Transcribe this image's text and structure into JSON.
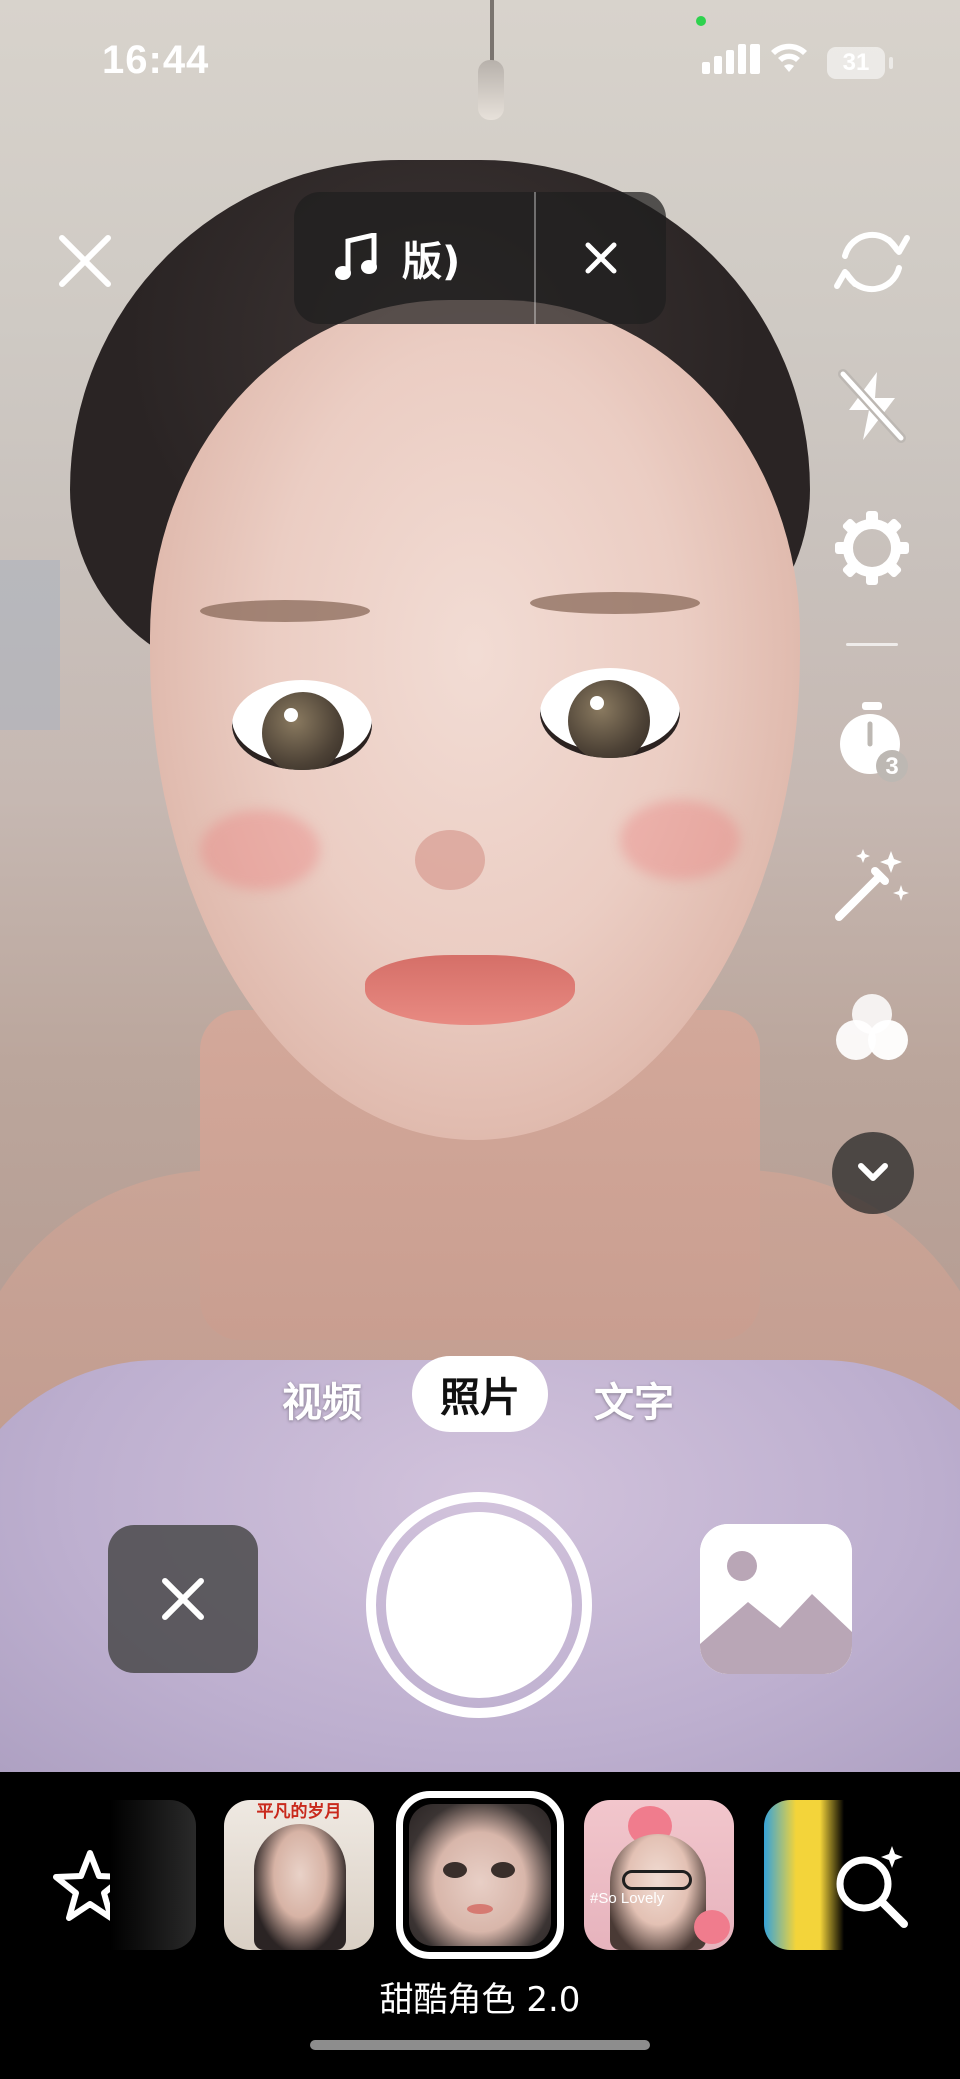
{
  "status_bar": {
    "time": "16:44",
    "battery": "31",
    "icons": [
      "camera-indicator-dot",
      "cellular-signal-icon",
      "wifi-icon",
      "battery-icon"
    ]
  },
  "top_bar": {
    "close_icon": "close-icon",
    "music": {
      "icon": "music-note-icon",
      "label": "版)",
      "remove_icon": "close-icon"
    }
  },
  "right_toolbar": {
    "items": [
      {
        "name": "flip-camera-icon"
      },
      {
        "name": "flash-off-icon"
      },
      {
        "name": "settings-gear-icon"
      },
      {
        "name": "timer-icon",
        "badge": "3"
      },
      {
        "name": "beauty-wand-icon"
      },
      {
        "name": "filters-icon"
      },
      {
        "name": "expand-more-icon"
      }
    ]
  },
  "modes": {
    "items": [
      "视频",
      "照片",
      "文字"
    ],
    "active": "照片"
  },
  "capture": {
    "cancel_icon": "close-icon",
    "shutter": "shutter-button",
    "gallery_icon": "gallery-image-icon"
  },
  "effects": {
    "favorite_icon": "star-icon",
    "thumb_1_text": "平凡的岁月",
    "thumb_3_text": "#So Lovely",
    "selected_name": "甜酷角色 2.0",
    "search_icon": "effect-search-icon"
  },
  "colors": {
    "accent_white": "#ffffff",
    "pill_bg": "#1e1e1e",
    "camera_dot": "#2ed24e"
  }
}
